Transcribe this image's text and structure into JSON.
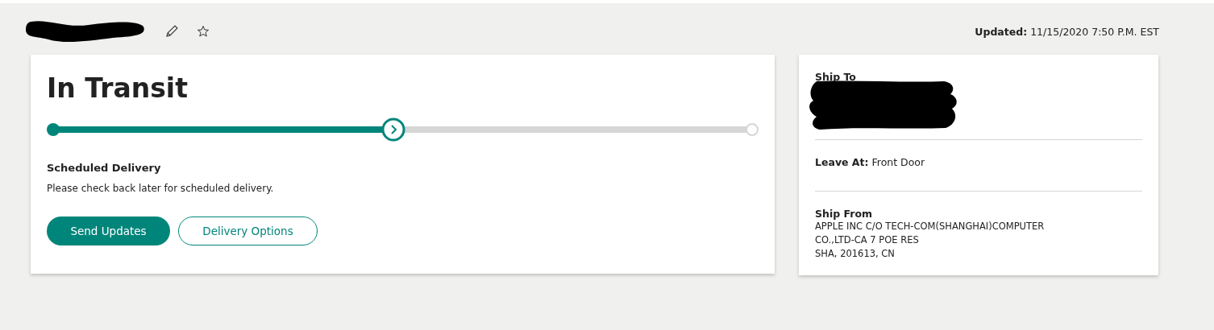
{
  "header": {
    "updated_label": "Updated:",
    "updated_value": "11/15/2020 7:50 P.M. EST"
  },
  "status": {
    "title": "In Transit",
    "progress": {
      "level": 0.487
    },
    "heading": "Scheduled Delivery",
    "message": "Please check back later for scheduled delivery.",
    "buttons": [
      {
        "label": "Send Updates",
        "kind": "primary"
      },
      {
        "label": "Delivery Options",
        "kind": "secondary"
      }
    ]
  },
  "details": {
    "ship_to_label": "Ship To",
    "leave_at_label": "Leave At:",
    "leave_at_value": "Front Door",
    "ship_from_label": "Ship From",
    "ship_from_lines": [
      "APPLE INC C/O TECH-COM(SHANGHAI)COMPUTER",
      "CO.,LTD-CA 7 POE RES",
      "SHA, 201613, CN"
    ]
  }
}
